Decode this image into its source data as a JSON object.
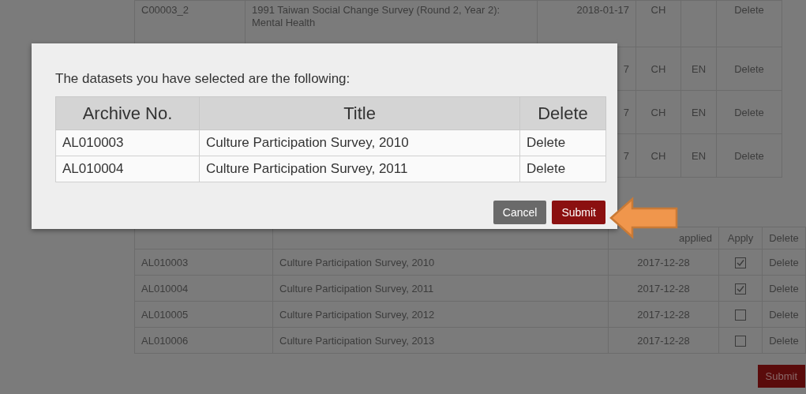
{
  "background_page": {
    "upper_table": {
      "rows": [
        {
          "archive_no": "C00003_2",
          "title": "1991 Taiwan Social Change Survey (Round 2, Year 2): Mental Health",
          "date": "2018-01-17",
          "ch": "CH",
          "en": "",
          "delete": "Delete"
        },
        {
          "date": "7",
          "ch": "CH",
          "en": "EN",
          "delete": "Delete"
        },
        {
          "date": "7",
          "ch": "CH",
          "en": "EN",
          "delete": "Delete"
        },
        {
          "date": "7",
          "ch": "CH",
          "en": "EN",
          "delete": "Delete"
        }
      ]
    },
    "lower_table": {
      "columns": [
        "applied",
        "Apply",
        "Delete"
      ],
      "rows": [
        {
          "archive_no": "AL010003",
          "title": "Culture Participation Survey, 2010",
          "date": "2017-12-28",
          "checked": true,
          "delete": "Delete"
        },
        {
          "archive_no": "AL010004",
          "title": "Culture Participation Survey, 2011",
          "date": "2017-12-28",
          "checked": true,
          "delete": "Delete"
        },
        {
          "archive_no": "AL010005",
          "title": "Culture Participation Survey, 2012",
          "date": "2017-12-28",
          "checked": false,
          "delete": "Delete"
        },
        {
          "archive_no": "AL010006",
          "title": "Culture Participation Survey, 2013",
          "date": "2017-12-28",
          "checked": false,
          "delete": "Delete"
        }
      ]
    },
    "submit_button": "Submit"
  },
  "dialog": {
    "message": "The datasets you have selected are the following:",
    "table": {
      "columns": [
        "Archive No.",
        "Title",
        "Delete"
      ],
      "rows": [
        {
          "archive_no": "AL010003",
          "title": "Culture Participation Survey, 2010",
          "delete": "Delete"
        },
        {
          "archive_no": "AL010004",
          "title": "Culture Participation Survey, 2011",
          "delete": "Delete"
        }
      ]
    },
    "buttons": [
      {
        "label": "Cancel",
        "kind": "secondary"
      },
      {
        "label": "Submit",
        "kind": "primary"
      }
    ]
  }
}
